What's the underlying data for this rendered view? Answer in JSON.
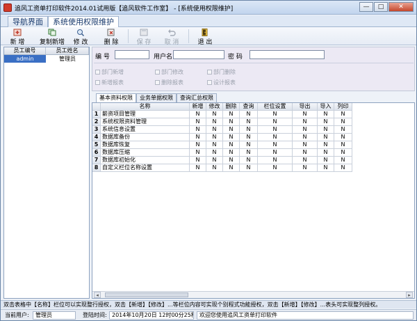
{
  "window": {
    "title": "追风工资单打印软件2014.01试用版【追风软件工作室】 - [系统使用权限维护]",
    "buttons": {
      "minimize": "—",
      "maximize": "□",
      "close": "✕"
    }
  },
  "nav_tabs": [
    {
      "label": "导航界面"
    },
    {
      "label": "系统使用权限维护"
    }
  ],
  "toolbar": {
    "new": "新 增",
    "copy_new": "复制新增",
    "edit": "修 改",
    "delete": "删 除",
    "save": "保 存",
    "cancel": "取 消",
    "exit": "退 出"
  },
  "employee_list": {
    "headers": [
      "员工编号",
      "员工姓名"
    ],
    "rows": [
      {
        "id": "admin",
        "name": "管理员"
      }
    ]
  },
  "form": {
    "id_label": "编 号",
    "username_label": "用户名",
    "password_label": "密 码",
    "id_value": "",
    "username_value": "",
    "password_value": "",
    "checkboxes": {
      "dept_add": "部门新增",
      "dept_edit": "部门修改",
      "dept_delete": "部门删除",
      "report_add": "新增报表",
      "report_delete": "删除报表",
      "report_design": "设计报表"
    }
  },
  "sub_tabs": [
    {
      "label": "基本资料权限"
    },
    {
      "label": "业务单据权限"
    },
    {
      "label": "查询汇总权限"
    }
  ],
  "grid": {
    "headers": [
      "名称",
      "新增",
      "修改",
      "删除",
      "查询",
      "栏位设置",
      "导出",
      "导入",
      "列印"
    ],
    "rows": [
      {
        "n": "1",
        "name": "薪资项目管理",
        "v": [
          "N",
          "N",
          "N",
          "N",
          "N",
          "N",
          "N",
          "N"
        ]
      },
      {
        "n": "2",
        "name": "系统权限资料管理",
        "v": [
          "N",
          "N",
          "N",
          "N",
          "N",
          "N",
          "N",
          "N"
        ]
      },
      {
        "n": "3",
        "name": "系统信息设置",
        "v": [
          "N",
          "N",
          "N",
          "N",
          "N",
          "N",
          "N",
          "N"
        ]
      },
      {
        "n": "4",
        "name": "数据库备份",
        "v": [
          "N",
          "N",
          "N",
          "N",
          "N",
          "N",
          "N",
          "N"
        ]
      },
      {
        "n": "5",
        "name": "数据库恢复",
        "v": [
          "N",
          "N",
          "N",
          "N",
          "N",
          "N",
          "N",
          "N"
        ]
      },
      {
        "n": "6",
        "name": "数据库压缩",
        "v": [
          "N",
          "N",
          "N",
          "N",
          "N",
          "N",
          "N",
          "N"
        ]
      },
      {
        "n": "7",
        "name": "数据库初始化",
        "v": [
          "N",
          "N",
          "N",
          "N",
          "N",
          "N",
          "N",
          "N"
        ]
      },
      {
        "n": "8",
        "name": "自定义栏位名称设置",
        "v": [
          "N",
          "N",
          "N",
          "N",
          "N",
          "N",
          "N",
          "N"
        ]
      }
    ]
  },
  "hint": "双击表格中【名称】栏位可以实现整行授权，双击【新增】【修改】...等栏位内容可实现个别程式功能授权，双击【新增】【修改】...表头可实现整列授权。",
  "status": {
    "user_label": "当前用户:",
    "user_value": "管理员",
    "login_label": "登陆时间:",
    "login_value": "2014年10月20日 12时00分25秒",
    "welcome": "欢迎您使用追风工资单打印软件"
  }
}
